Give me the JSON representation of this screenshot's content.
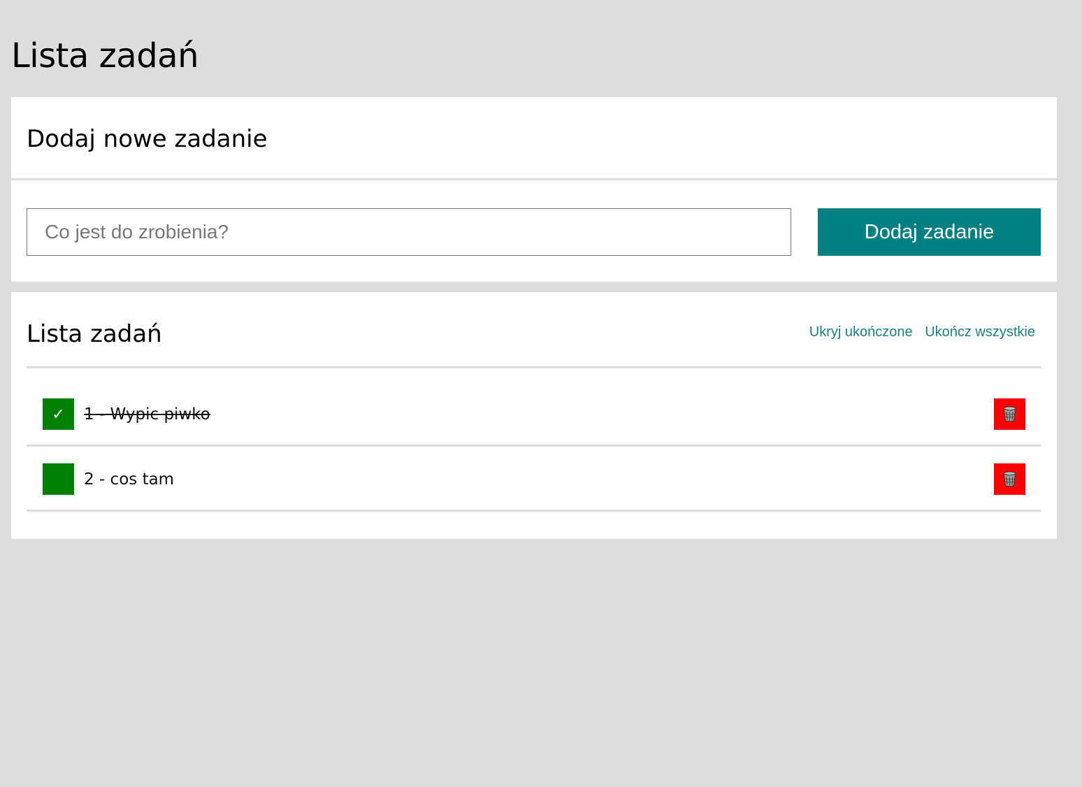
{
  "page": {
    "title": "Lista zadań"
  },
  "add_panel": {
    "title": "Dodaj nowe zadanie",
    "input_placeholder": "Co jest do zrobienia?",
    "input_value": "",
    "button_label": "Dodaj zadanie"
  },
  "list_panel": {
    "title": "Lista zadań",
    "hide_completed_label": "Ukryj ukończone",
    "complete_all_label": "Ukończ wszystkie",
    "tasks": [
      {
        "text": "1 - Wypic piwko",
        "done": true,
        "check_glyph": "✓"
      },
      {
        "text": "2 - cos tam",
        "done": false,
        "check_glyph": ""
      }
    ]
  },
  "colors": {
    "background": "#dddddd",
    "accent": "#008080",
    "check": "#008000",
    "delete": "#ff0000",
    "link": "#1a7f7f"
  },
  "icons": {
    "check": "check-icon",
    "delete": "trash-icon"
  }
}
